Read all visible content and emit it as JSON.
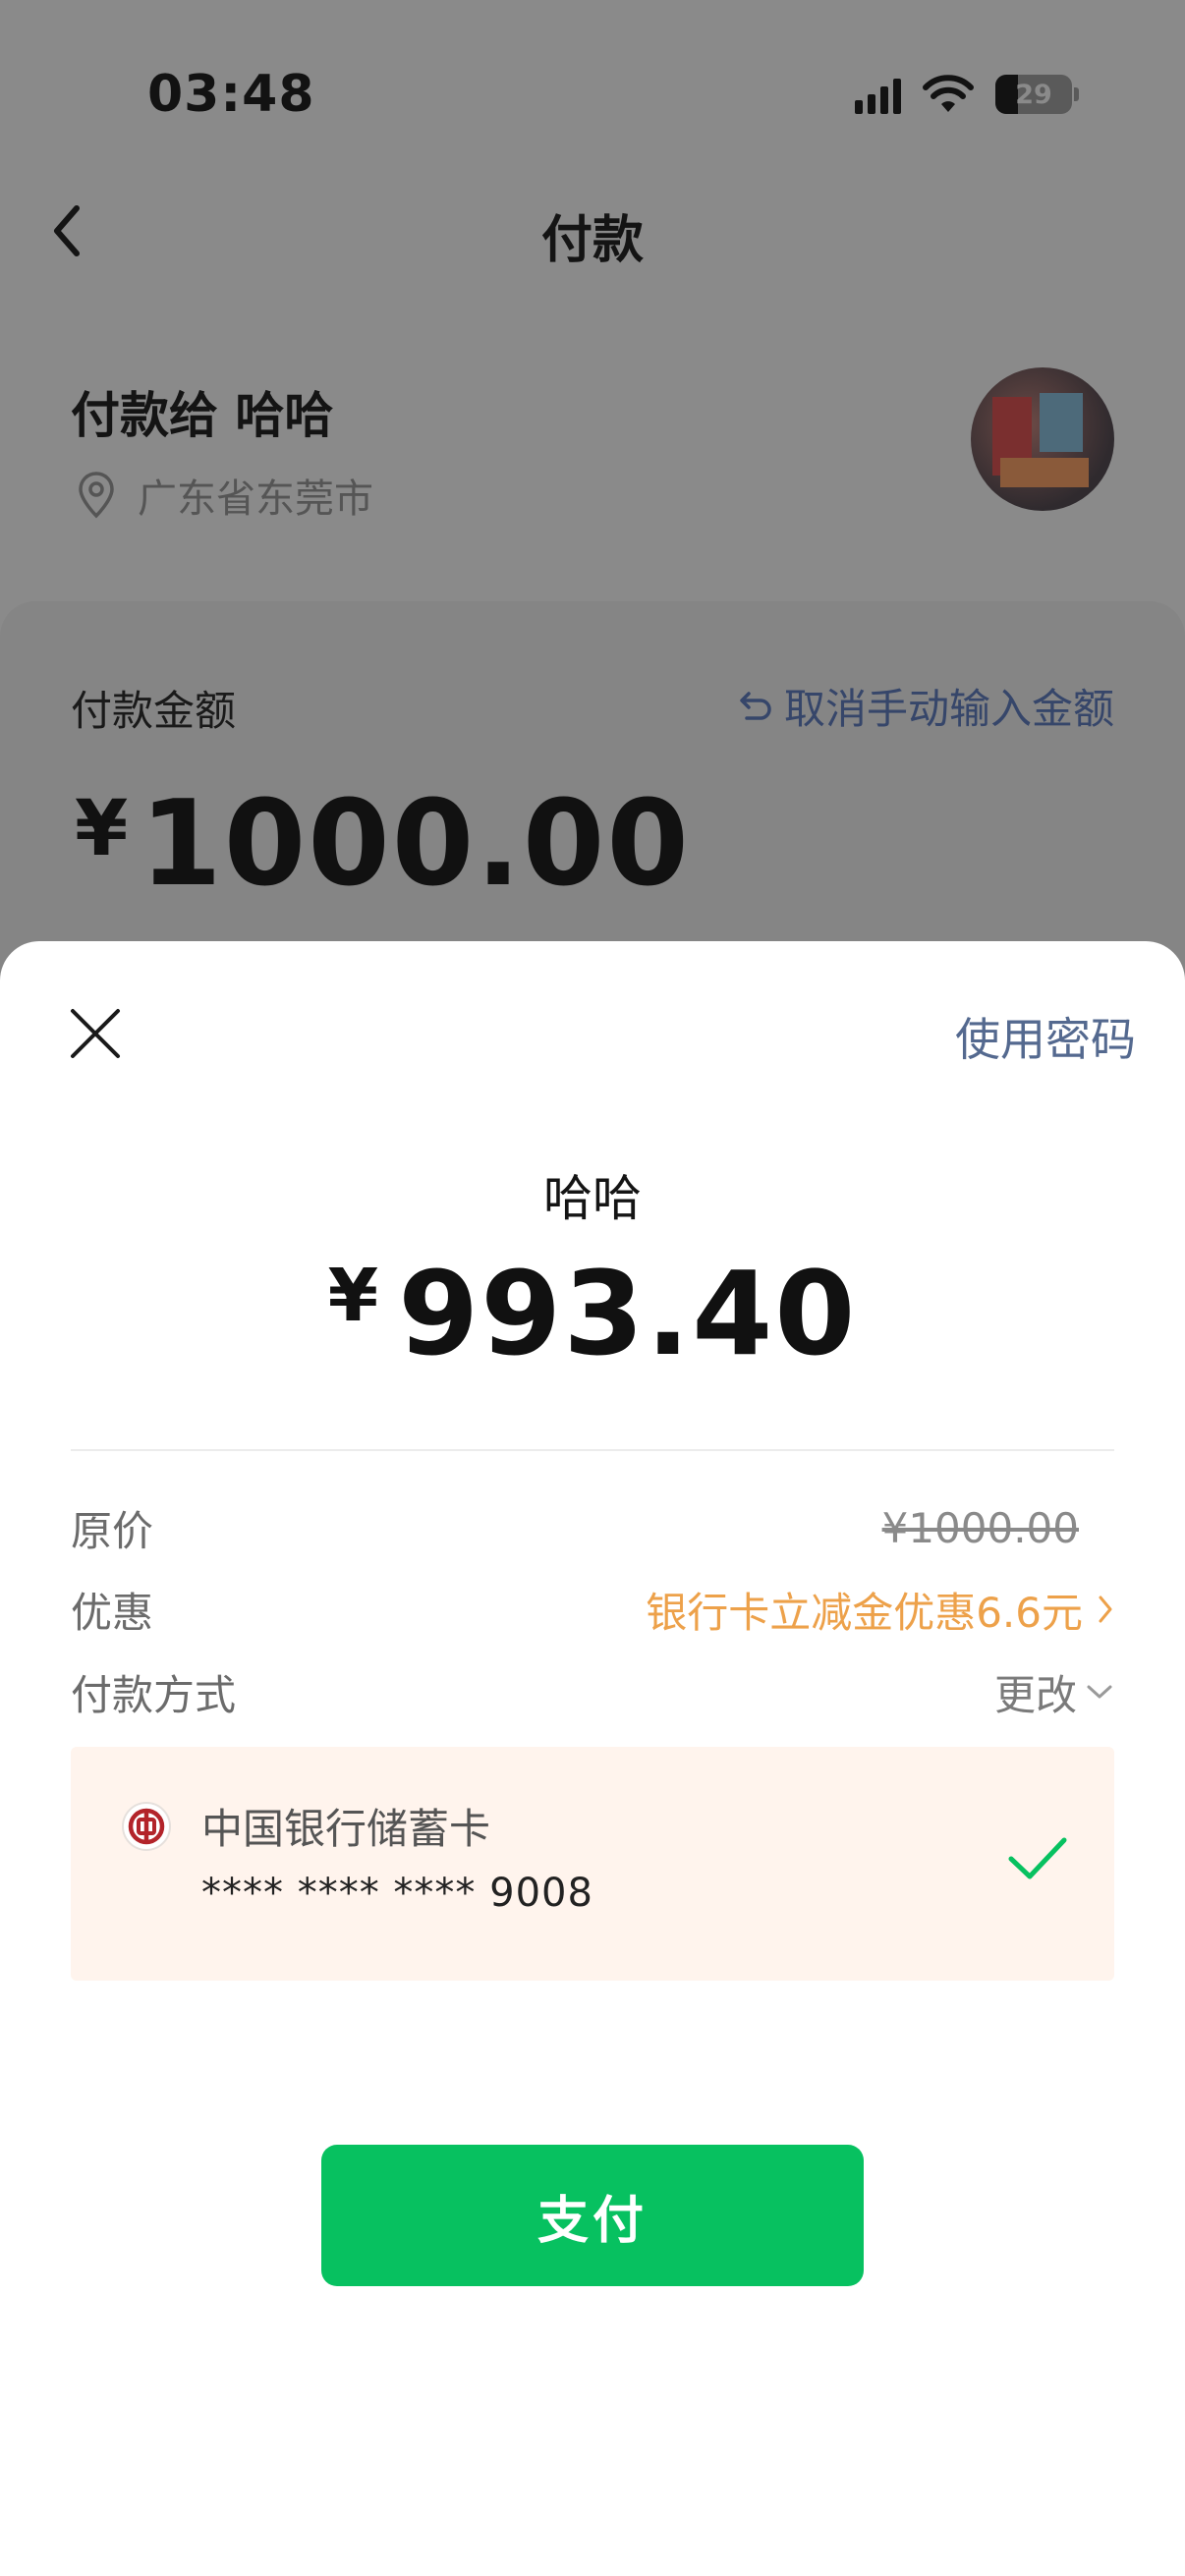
{
  "status_bar": {
    "time": "03:48",
    "battery": "29",
    "battery_level": 0.29
  },
  "nav": {
    "title": "付款"
  },
  "payee": {
    "label": "付款给 哈哈",
    "location": "广东省东莞市"
  },
  "amount_card": {
    "label": "付款金额",
    "cancel_manual": "取消手动输入金额",
    "currency": "¥",
    "amount": "1000.00"
  },
  "sheet": {
    "use_password": "使用密码",
    "merchant": "哈哈",
    "currency": "¥",
    "amount": "993.40",
    "rows": {
      "original_label": "原价",
      "original_value": "¥1000.00",
      "discount_label": "优惠",
      "discount_value": "银行卡立减金优惠6.6元",
      "method_label": "付款方式",
      "method_change": "更改"
    },
    "card": {
      "bank_name": "中国银行储蓄卡",
      "number": "**** **** **** 9008"
    },
    "pay_button": "支付"
  },
  "colors": {
    "accent_green": "#07c160",
    "link_blue": "#54698f",
    "discount_orange": "#eda14a",
    "card_bg": "#fff4ed"
  }
}
